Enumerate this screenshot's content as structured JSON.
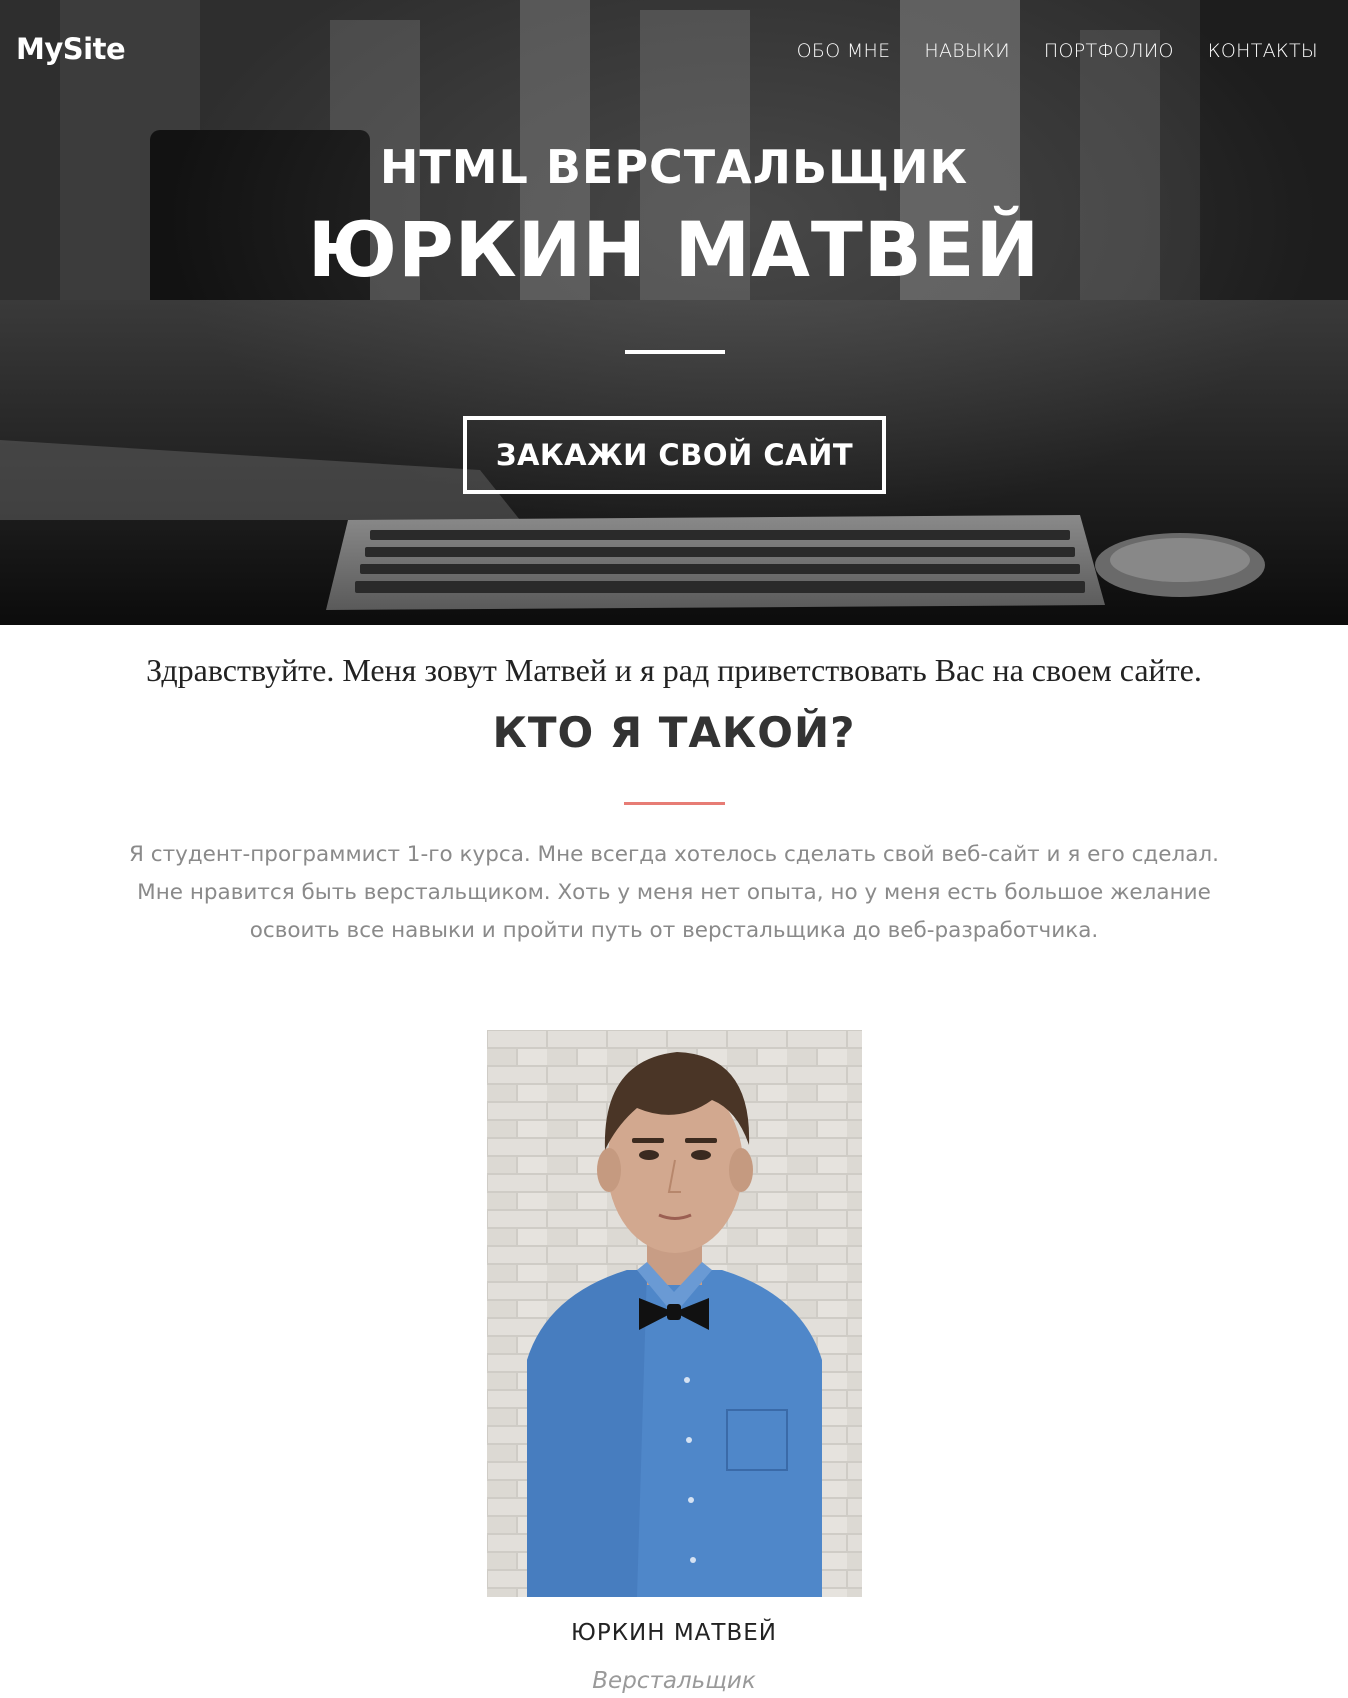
{
  "header": {
    "logo": "MySite",
    "nav": [
      {
        "label": "ОБО МНЕ"
      },
      {
        "label": "НАВЫКИ"
      },
      {
        "label": "ПОРТФОЛИО"
      },
      {
        "label": "КОНТАКТЫ"
      }
    ]
  },
  "hero": {
    "subtitle": "HTML ВЕРСТАЛЬЩИК",
    "title": "ЮРКИН МАТВЕЙ",
    "cta_label": "ЗАКАЖИ СВОЙ САЙТ"
  },
  "about": {
    "greeting": "Здравствуйте. Меня зовут Матвей и я рад приветствовать Вас на своем сайте.",
    "title": "КТО Я ТАКОЙ?",
    "text_lines": [
      "Я студент-программист 1-го курса. Мне всегда хотелось сделать свой веб-сайт и я его сделал.",
      "Мне нравится быть верстальщиком. Хоть у меня нет опыта, но у меня есть большое желание",
      "освоить все навыки и пройти путь от верстальщика до веб-разработчика."
    ],
    "accent_color": "#e77c75"
  },
  "profile": {
    "name": "ЮРКИН МАТВЕЙ",
    "role": "Верстальщик"
  }
}
